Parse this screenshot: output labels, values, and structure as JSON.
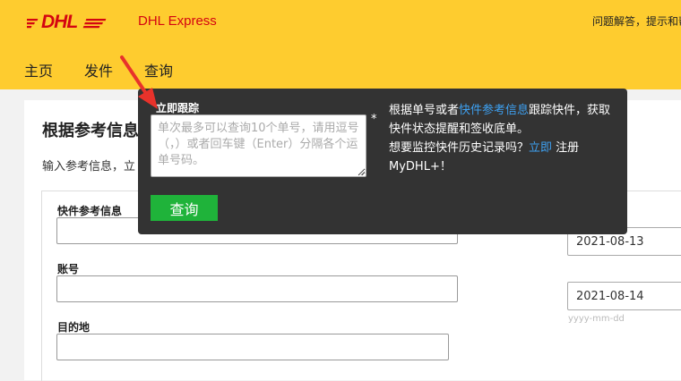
{
  "header": {
    "logo_text": "DHL",
    "brand": "DHL Express",
    "help_text": "问题解答，提示和帮"
  },
  "nav": {
    "items": [
      {
        "label": "主页"
      },
      {
        "label": "发件"
      },
      {
        "label": "查询"
      }
    ]
  },
  "card": {
    "title": "根据参考信息",
    "subtitle": "输入参考信息，立"
  },
  "form": {
    "reference_label": "快件参考信息",
    "account_label": "账号",
    "destination_label": "目的地",
    "date_from": "2021-08-13",
    "date_to": "2021-08-14",
    "date_hint": "yyyy-mm-dd"
  },
  "popover": {
    "label": "立即跟踪",
    "textarea_placeholder": "单次最多可以查询10个单号，请用逗号（，）或者回车键（Enter）分隔各个运单号码。",
    "asterisk": "*",
    "button": "查询",
    "info_part1": "根据单号或者",
    "info_link": "快件参考信息",
    "info_part2": "跟踪快件，获取快件状态提醒和签收底单。",
    "info_part3": "想要监控快件历史记录吗？",
    "info_link2": "立即",
    "info_part4": " 注册 MyDHL+！"
  },
  "colors": {
    "header_yellow": "#fecc2f",
    "dhl_red": "#d40511",
    "popover_bg": "#333333",
    "button_green": "#1fb33a",
    "link_blue": "#3ea1f2",
    "arrow_red": "#e8322b"
  }
}
